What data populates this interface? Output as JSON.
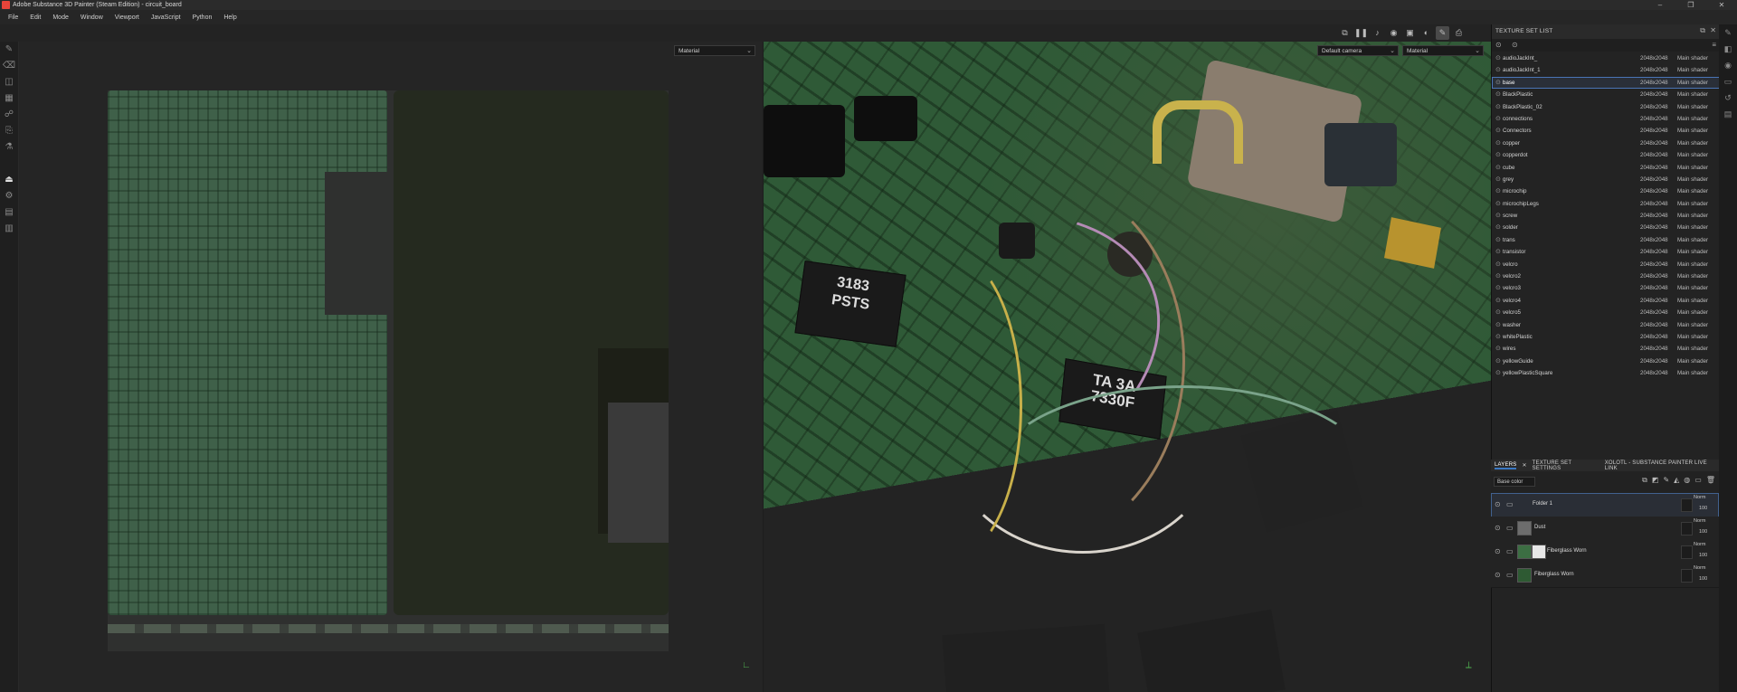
{
  "window": {
    "title": "Adobe Substance 3D Painter (Steam Edition) - circuit_board",
    "controls": [
      "–",
      "❐",
      "✕"
    ]
  },
  "menu": [
    "File",
    "Edit",
    "Mode",
    "Window",
    "Viewport",
    "JavaScript",
    "Python",
    "Help"
  ],
  "viewport2d": {
    "channel_dropdown": "Material"
  },
  "viewport3d": {
    "camera_dropdown": "Default camera",
    "channel_dropdown": "Material",
    "chip1_label": "3183\nPSTS",
    "chip2_label": "TA  3A\n7330F"
  },
  "texture_set_list": {
    "title": "TEXTURE SET LIST",
    "items": [
      {
        "name": "audioJackInt_",
        "res": "2048x2048",
        "shader": "Main shader"
      },
      {
        "name": "audioJackInt_1",
        "res": "2048x2048",
        "shader": "Main shader"
      },
      {
        "name": "base",
        "res": "2048x2048",
        "shader": "Main shader",
        "selected": true
      },
      {
        "name": "BlackPlastic",
        "res": "2048x2048",
        "shader": "Main shader"
      },
      {
        "name": "BlackPlastic_02",
        "res": "2048x2048",
        "shader": "Main shader"
      },
      {
        "name": "connections",
        "res": "2048x2048",
        "shader": "Main shader"
      },
      {
        "name": "Connectors",
        "res": "2048x2048",
        "shader": "Main shader"
      },
      {
        "name": "copper",
        "res": "2048x2048",
        "shader": "Main shader"
      },
      {
        "name": "copperdot",
        "res": "2048x2048",
        "shader": "Main shader"
      },
      {
        "name": "cube",
        "res": "2048x2048",
        "shader": "Main shader"
      },
      {
        "name": "grey",
        "res": "2048x2048",
        "shader": "Main shader"
      },
      {
        "name": "microchip",
        "res": "2048x2048",
        "shader": "Main shader"
      },
      {
        "name": "microchipLegs",
        "res": "2048x2048",
        "shader": "Main shader"
      },
      {
        "name": "screw",
        "res": "2048x2048",
        "shader": "Main shader"
      },
      {
        "name": "solder",
        "res": "2048x2048",
        "shader": "Main shader"
      },
      {
        "name": "trans",
        "res": "2048x2048",
        "shader": "Main shader"
      },
      {
        "name": "transistor",
        "res": "2048x2048",
        "shader": "Main shader"
      },
      {
        "name": "velcro",
        "res": "2048x2048",
        "shader": "Main shader"
      },
      {
        "name": "velcro2",
        "res": "2048x2048",
        "shader": "Main shader"
      },
      {
        "name": "velcro3",
        "res": "2048x2048",
        "shader": "Main shader"
      },
      {
        "name": "velcro4",
        "res": "2048x2048",
        "shader": "Main shader"
      },
      {
        "name": "velcro5",
        "res": "2048x2048",
        "shader": "Main shader"
      },
      {
        "name": "washer",
        "res": "2048x2048",
        "shader": "Main shader"
      },
      {
        "name": "whitePlastic",
        "res": "2048x2048",
        "shader": "Main shader"
      },
      {
        "name": "wires",
        "res": "2048x2048",
        "shader": "Main shader"
      },
      {
        "name": "yellowGuide",
        "res": "2048x2048",
        "shader": "Main shader"
      },
      {
        "name": "yellowPlasticSquare",
        "res": "2048x2048",
        "shader": "Main shader"
      }
    ]
  },
  "layers_panel": {
    "tabs": [
      "LAYERS",
      "TEXTURE SET SETTINGS",
      "XOLOTL - SUBSTANCE PAINTER LIVE LINK"
    ],
    "channel_dropdown": "Base color",
    "layers": [
      {
        "name": "Folder 1",
        "blend": "Norm",
        "opacity": "100",
        "selected": true
      },
      {
        "name": "Dust",
        "blend": "Norm",
        "opacity": "100"
      },
      {
        "name": "Fiberglass Worn",
        "blend": "Norm",
        "opacity": "100"
      },
      {
        "name": "Fiberglass Worn",
        "blend": "Norm",
        "opacity": "100"
      }
    ]
  },
  "colors": {
    "accent": "#3a78c3",
    "background": "#1d1d1d",
    "board_green": "#2f5a37"
  }
}
